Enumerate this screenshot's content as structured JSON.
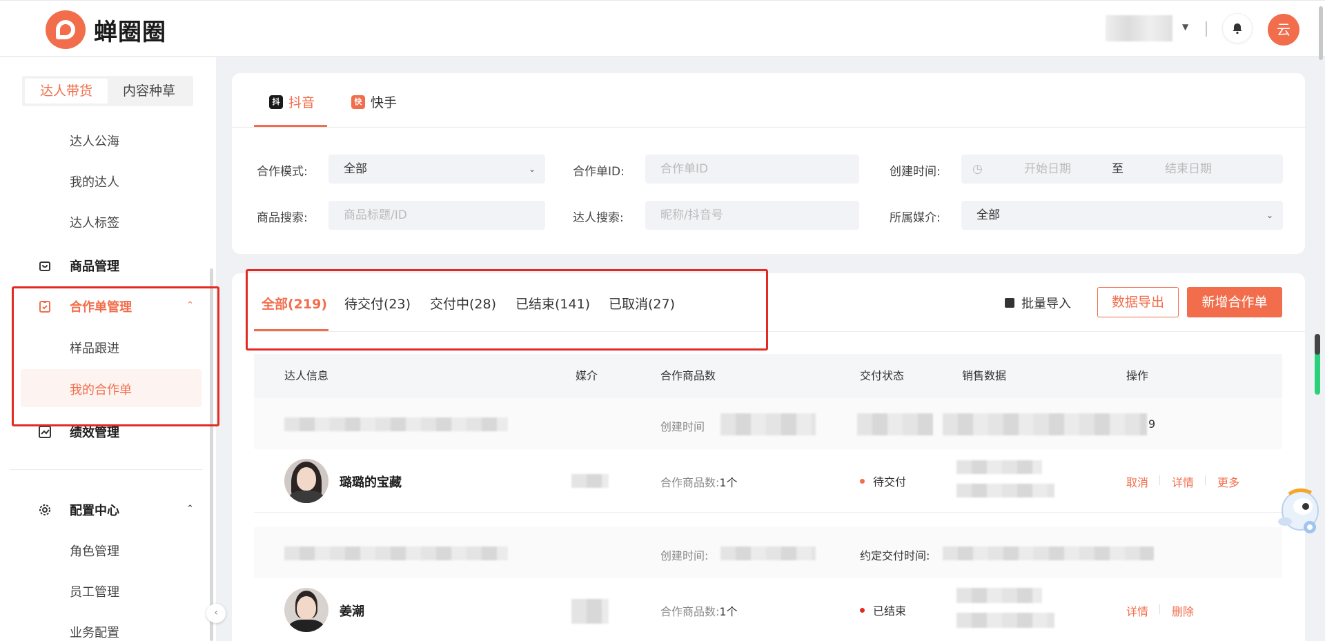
{
  "app": {
    "logo_text": "蝉圈圈",
    "user_avatar_char": "云"
  },
  "sidebar": {
    "segments": [
      "达人带货",
      "内容种草"
    ],
    "talent_items": [
      "达人公海",
      "我的达人",
      "达人标签"
    ],
    "product_mgmt": "商品管理",
    "order_mgmt": "合作单管理",
    "order_items": [
      "样品跟进",
      "我的合作单"
    ],
    "perf_mgmt": "绩效管理",
    "config_center": "配置中心",
    "config_items": [
      "角色管理",
      "员工管理",
      "业务配置"
    ]
  },
  "platform_tabs": [
    {
      "badge": "抖",
      "label": "抖音",
      "badge_color": "#1a1a1a"
    },
    {
      "badge": "快",
      "label": "快手",
      "badge_color": "#f26d4b"
    }
  ],
  "filters": {
    "mode_label": "合作模式:",
    "mode_value": "全部",
    "order_id_label": "合作单ID:",
    "order_id_placeholder": "合作单ID",
    "created_label": "创建时间:",
    "start_placeholder": "开始日期",
    "range_sep": "至",
    "end_placeholder": "结束日期",
    "product_label": "商品搜索:",
    "product_placeholder": "商品标题/ID",
    "talent_label": "达人搜索:",
    "talent_placeholder": "昵称/抖音号",
    "media_label": "所属媒介:",
    "media_value": "全部"
  },
  "status_tabs": [
    "全部(219)",
    "待交付(23)",
    "交付中(28)",
    "已结束(141)",
    "已取消(27)"
  ],
  "actions": {
    "import": "批量导入",
    "export": "数据导出",
    "new": "新增合作单"
  },
  "table": {
    "headers": [
      "达人信息",
      "媒介",
      "合作商品数",
      "交付状态",
      "销售数据",
      "操作"
    ],
    "created_label": "创建时间",
    "created_label_colon": "创建时间:",
    "deadline_label": "约定交付时间:",
    "trailing_digit": "9",
    "rows": [
      {
        "name": "璐璐的宝藏",
        "products_label": "合作商品数:",
        "products_value": "1个",
        "status": "待交付",
        "actions": [
          "取消",
          "详情",
          "更多"
        ]
      },
      {
        "name": "姜潮",
        "products_label": "合作商品数:",
        "products_value": "1个",
        "status": "已结束",
        "actions": [
          "详情",
          "删除"
        ]
      }
    ]
  },
  "colors": {
    "accent": "#f26d4b",
    "highlight_box": "#e32a22",
    "pending_dot": "#f26d4b",
    "ended_dot": "#e32a22"
  }
}
